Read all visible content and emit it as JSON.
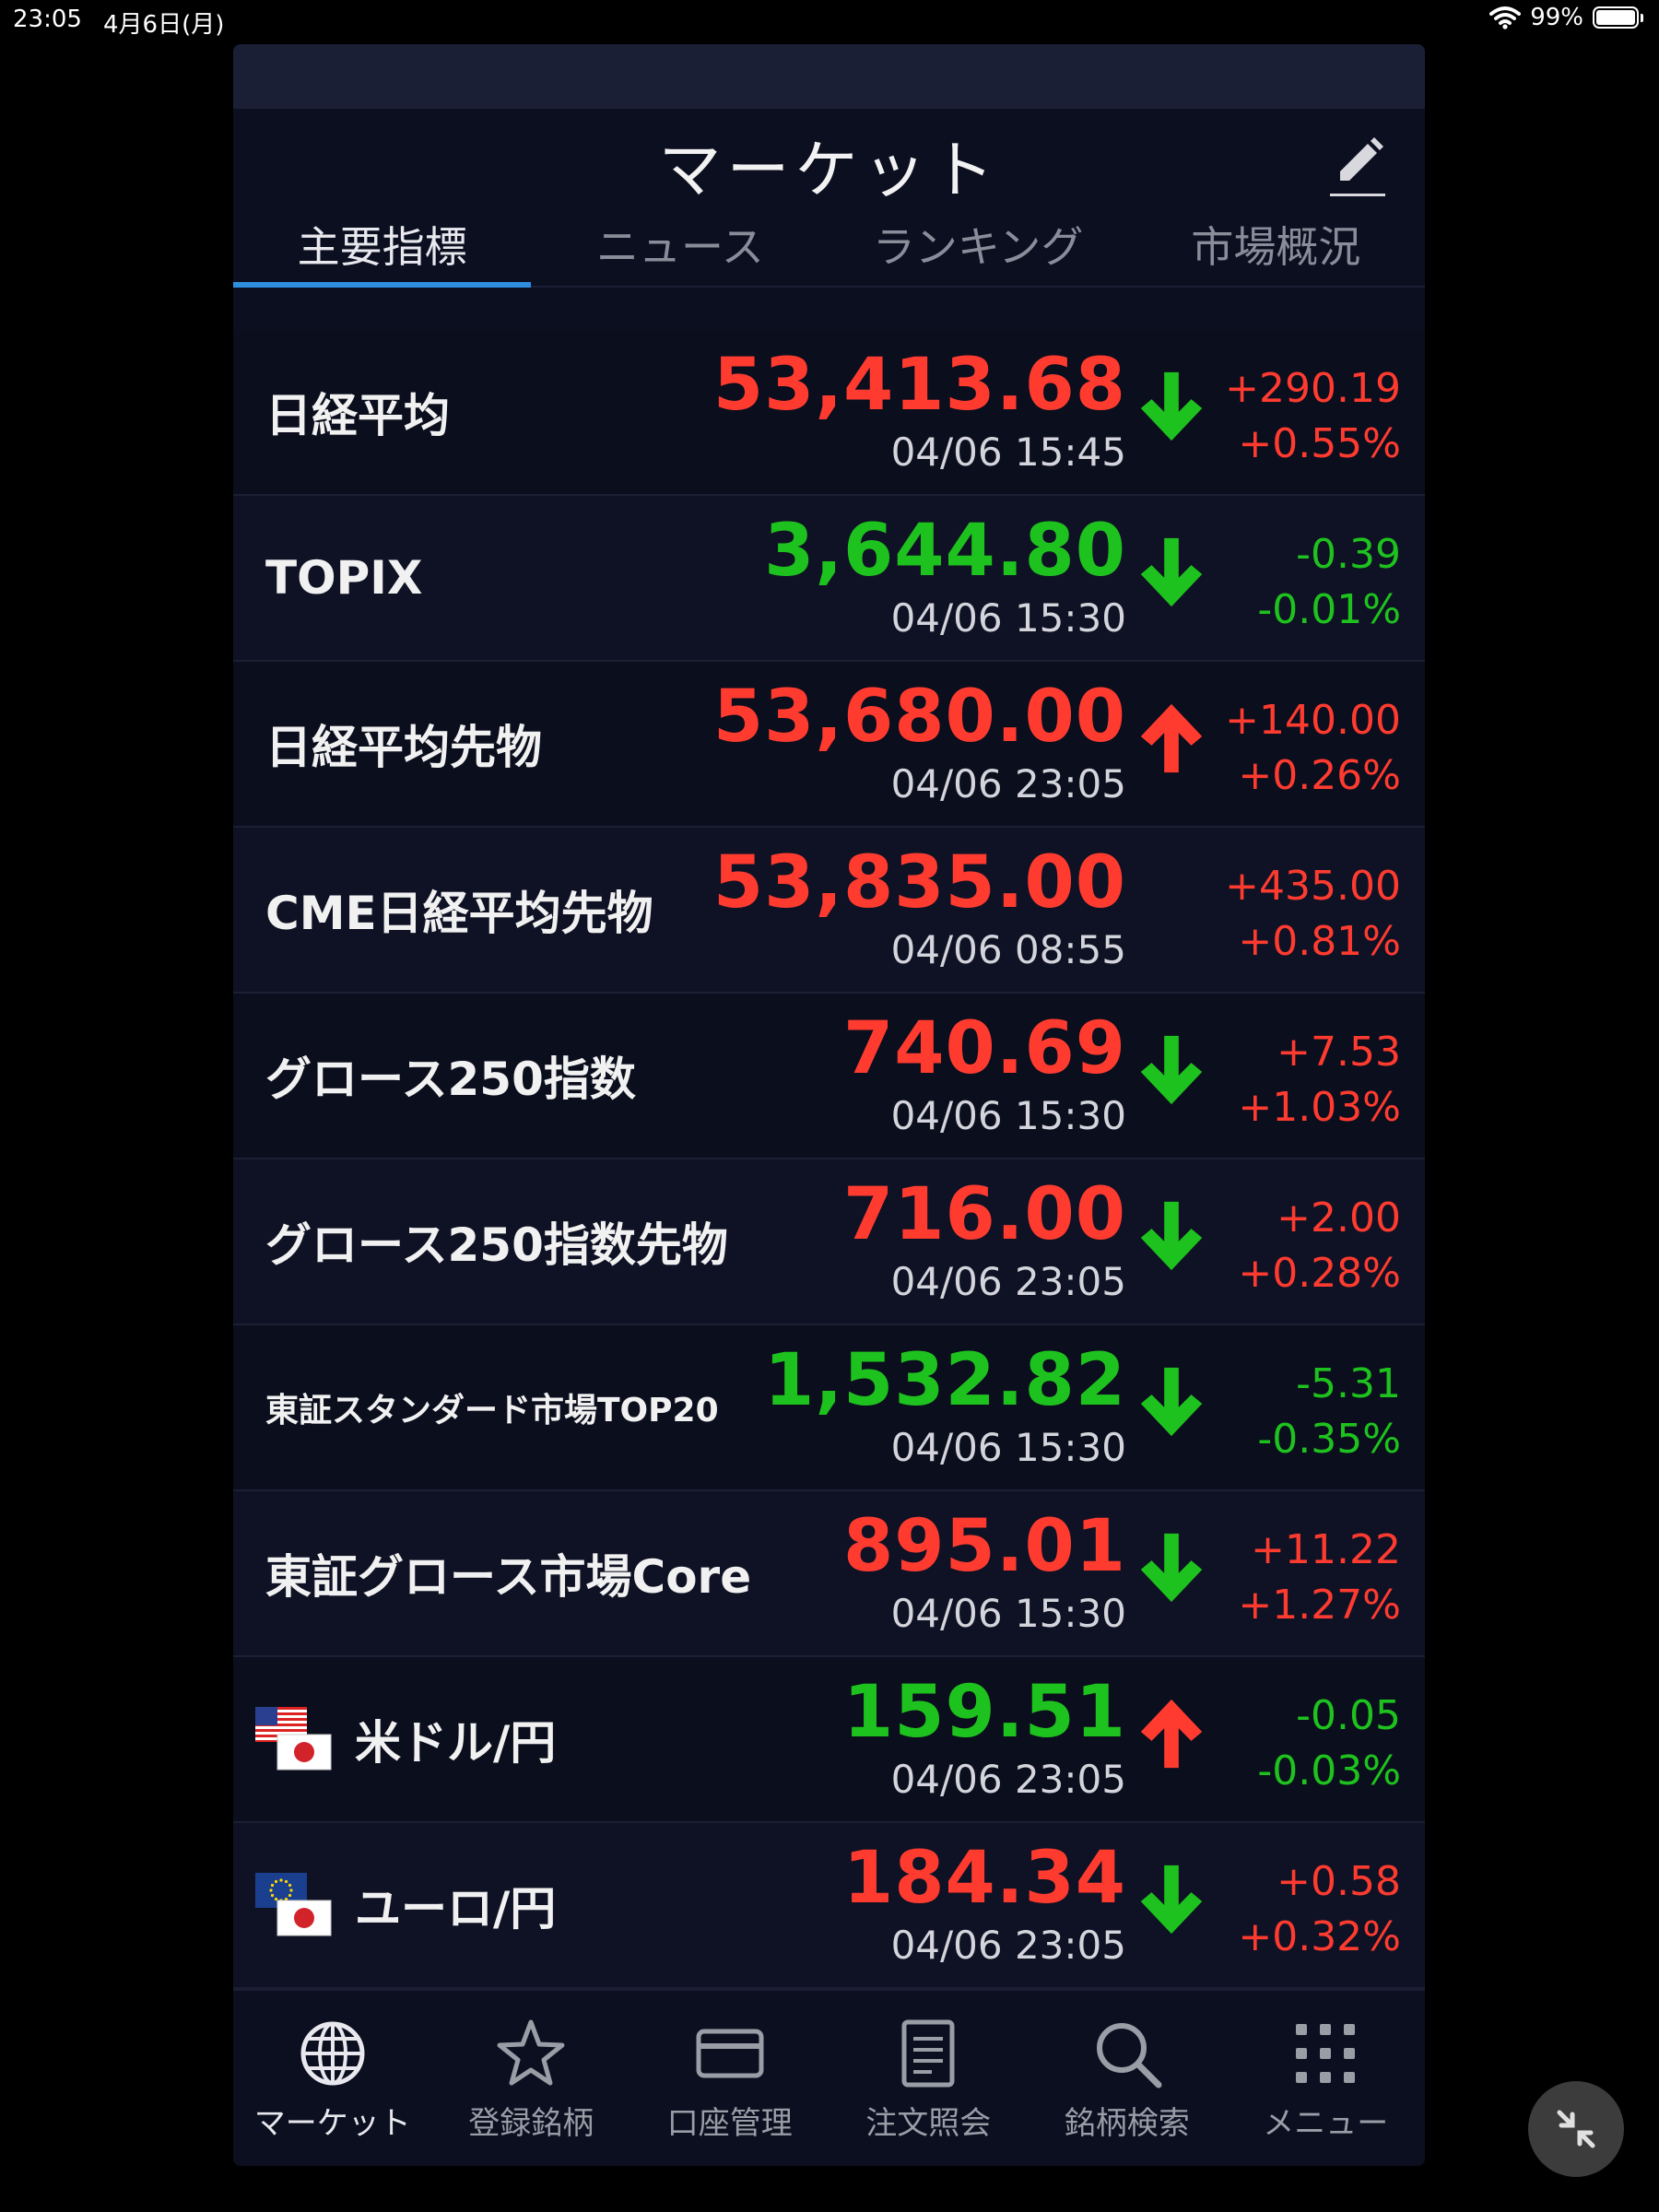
{
  "status_bar": {
    "time": "23:05",
    "date": "4月6日(月)",
    "battery": "99%"
  },
  "header": {
    "title": "マーケット"
  },
  "tabs": [
    {
      "label": "主要指標",
      "active": true
    },
    {
      "label": "ニュース",
      "active": false
    },
    {
      "label": "ランキング",
      "active": false
    },
    {
      "label": "市場概況",
      "active": false
    }
  ],
  "rows": [
    {
      "name": "日経平均",
      "price": "53,413.68",
      "time": "04/06 15:45",
      "change": "+290.19",
      "percent": "+0.55%",
      "price_color": "red",
      "change_color": "red",
      "arrow": "down"
    },
    {
      "name": "TOPIX",
      "price": "3,644.80",
      "time": "04/06 15:30",
      "change": "-0.39",
      "percent": "-0.01%",
      "price_color": "green",
      "change_color": "green",
      "arrow": "down"
    },
    {
      "name": "日経平均先物",
      "price": "53,680.00",
      "time": "04/06 23:05",
      "change": "+140.00",
      "percent": "+0.26%",
      "price_color": "red",
      "change_color": "red",
      "arrow": "up"
    },
    {
      "name": "CME日経平均先物",
      "price": "53,835.00",
      "time": "04/06 08:55",
      "change": "+435.00",
      "percent": "+0.81%",
      "price_color": "red",
      "change_color": "red",
      "arrow": "none"
    },
    {
      "name": "グロース250指数",
      "price": "740.69",
      "time": "04/06 15:30",
      "change": "+7.53",
      "percent": "+1.03%",
      "price_color": "red",
      "change_color": "red",
      "arrow": "down"
    },
    {
      "name": "グロース250指数先物",
      "price": "716.00",
      "time": "04/06 23:05",
      "change": "+2.00",
      "percent": "+0.28%",
      "price_color": "red",
      "change_color": "red",
      "arrow": "down"
    },
    {
      "name": "東証スタンダード市場TOP20",
      "price": "1,532.82",
      "time": "04/06 15:30",
      "change": "-5.31",
      "percent": "-0.35%",
      "price_color": "green",
      "change_color": "green",
      "arrow": "down"
    },
    {
      "name": "東証グロース市場Core",
      "price": "895.01",
      "time": "04/06 15:30",
      "change": "+11.22",
      "percent": "+1.27%",
      "price_color": "red",
      "change_color": "red",
      "arrow": "down"
    },
    {
      "name": "米ドル/円",
      "price": "159.51",
      "time": "04/06 23:05",
      "change": "-0.05",
      "percent": "-0.03%",
      "price_color": "green",
      "change_color": "green",
      "arrow": "up"
    },
    {
      "name": "ユーロ/円",
      "price": "184.34",
      "time": "04/06 23:05",
      "change": "+0.58",
      "percent": "+0.32%",
      "price_color": "red",
      "change_color": "red",
      "arrow": "down"
    }
  ],
  "bottom_nav": [
    {
      "label": "マーケット",
      "icon": "globe-icon",
      "active": true
    },
    {
      "label": "登録銘柄",
      "icon": "star-icon",
      "active": false
    },
    {
      "label": "口座管理",
      "icon": "card-icon",
      "active": false
    },
    {
      "label": "注文照会",
      "icon": "document-icon",
      "active": false
    },
    {
      "label": "銘柄検索",
      "icon": "search-icon",
      "active": false
    },
    {
      "label": "メニュー",
      "icon": "grid-menu-icon",
      "active": false
    }
  ],
  "colors": {
    "up_red": "#ff3b30",
    "down_green": "#1ec21e",
    "accent_blue": "#2e8fe0",
    "background": "#0c0f20"
  }
}
